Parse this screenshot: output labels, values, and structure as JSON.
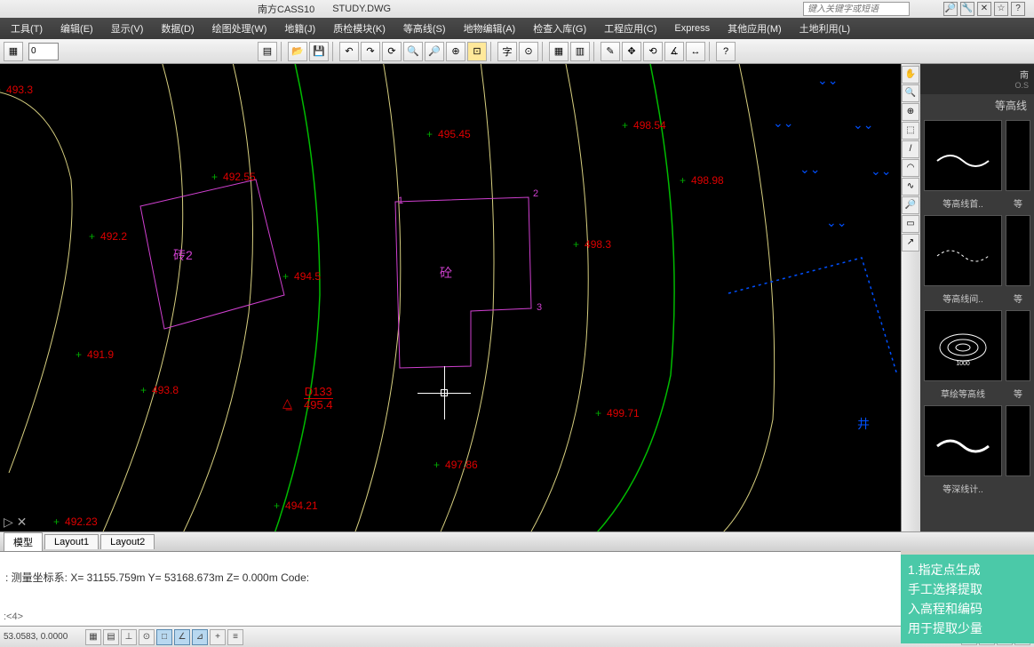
{
  "title": {
    "app": "南方CASS10",
    "file": "STUDY.DWG",
    "search_ph": "键入关键字或短语"
  },
  "menu": [
    "工具(T)",
    "编辑(E)",
    "显示(V)",
    "数据(D)",
    "绘图处理(W)",
    "地籍(J)",
    "质检模块(K)",
    "等高线(S)",
    "地物编辑(A)",
    "检查入库(G)",
    "工程应用(C)",
    "Express",
    "其他应用(M)",
    "土地利用(L)"
  ],
  "layer": "0",
  "tabs": [
    "模型",
    "Layout1",
    "Layout2"
  ],
  "cmd": {
    "line": "测量坐标系: X= 31155.759m  Y= 53168.673m  Z= 0.000m  Code:",
    "prompt": ":<4>"
  },
  "status": {
    "coords": "53.0583, 0.0000",
    "model": "模型"
  },
  "rpanel": {
    "hdr1": "南",
    "hdr2": "O.S",
    "title": "等高线",
    "items": [
      "等高线首..",
      "等",
      "等高线间..",
      "等",
      "草绘等高线",
      "等",
      "等深线计..",
      ""
    ]
  },
  "points": {
    "p1": "493.3",
    "p2": "492.55",
    "p3": "492.2",
    "p4": "494.5",
    "p5": "491.9",
    "p6": "493.8",
    "p7": "492.23",
    "p8": "494.21",
    "p9": "495.45",
    "p10": "497.86",
    "p11": "498.3",
    "p12": "498.54",
    "p13": "498.98",
    "p14": "499.71"
  },
  "bldg": {
    "b1": "砖2",
    "b2": "砼",
    "v1": "1",
    "v2": "2",
    "v3": "3"
  },
  "anno": {
    "code": "D133",
    "elev": "495.4"
  },
  "jing": "井",
  "tooltip": {
    "l1": "1.指定点生成",
    "l2": "手工选择提取",
    "l3": "入高程和编码",
    "l4": "用于提取少量"
  }
}
